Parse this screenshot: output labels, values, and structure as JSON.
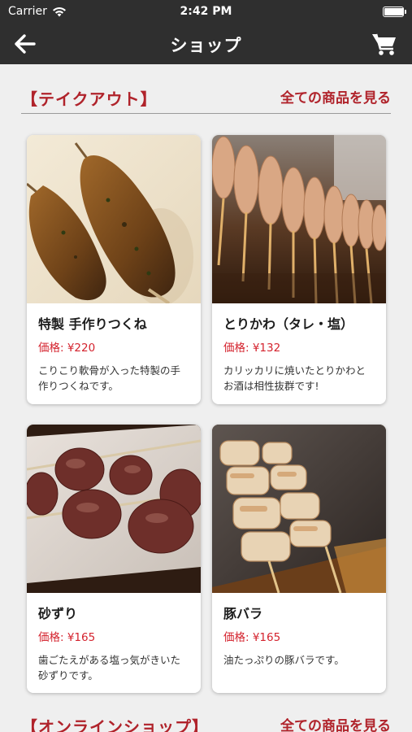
{
  "status_bar": {
    "carrier": "Carrier",
    "time": "2:42 PM",
    "battery_level": 1.0
  },
  "nav": {
    "title": "ショップ",
    "back_icon": "arrow-left-icon",
    "cart_icon": "shopping-cart-icon"
  },
  "takeout": {
    "title": "【テイクアウト】",
    "see_all": "全ての商品を見る",
    "products": [
      {
        "name": "特製 手作りつくね",
        "price": "価格: ¥220",
        "description": "こりこり軟骨が入った特製の手作りつくねです。"
      },
      {
        "name": "とりかわ（タレ・塩）",
        "price": "価格: ¥132",
        "description": "カリッカリに焼いたとりかわとお酒は相性抜群です!"
      },
      {
        "name": "砂ずり",
        "price": "価格: ¥165",
        "description": "歯ごたえがある塩っ気がきいた砂ずりです。"
      },
      {
        "name": "豚バラ",
        "price": "価格: ¥165",
        "description": "油たっぷりの豚バラです。"
      }
    ]
  },
  "online": {
    "title": "【オンラインショップ】",
    "see_all": "全ての商品を見る"
  },
  "colors": {
    "accent": "#b0232b",
    "price": "#d4232e",
    "header_bg": "#2f2f2f",
    "page_bg": "#efefef"
  }
}
